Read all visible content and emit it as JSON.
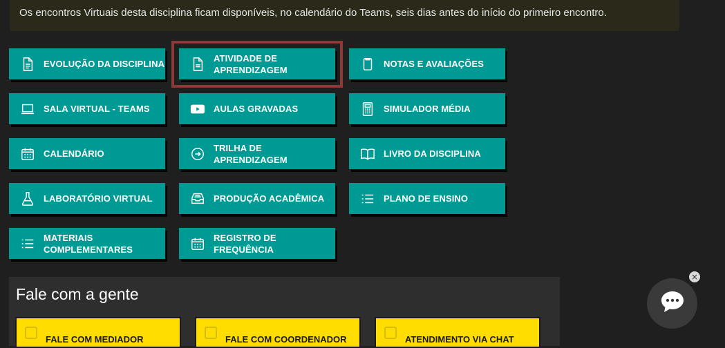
{
  "notice": {
    "text": "Os encontros Virtuais desta disciplina ficam disponíveis, no calendário do Teams, seis dias antes do início do primeiro encontro."
  },
  "menu": {
    "evolucao": "EVOLUÇÃO DA DISCIPLINA",
    "atividade_l1": "ATIVIDADE DE",
    "atividade_l2": "APRENDIZAGEM",
    "notas": "NOTAS E AVALIAÇÕES",
    "sala": "SALA VIRTUAL - TEAMS",
    "aulas": "AULAS GRAVADAS",
    "simulador": "SIMULADOR MÉDIA",
    "calendario": "CALENDÁRIO",
    "trilha_l1": "TRILHA DE",
    "trilha_l2": "APRENDIZAGEM",
    "livro": "LIVRO DA DISCIPLINA",
    "laboratorio": "LABORATÓRIO VIRTUAL",
    "producao": "PRODUÇÃO ACADÊMICA",
    "plano": "PLANO DE ENSINO",
    "materiais_l1": "MATERIAIS",
    "materiais_l2": "COMPLEMENTARES",
    "registro": "REGISTRO DE FREQUÊNCIA"
  },
  "contact": {
    "title": "Fale com a gente",
    "mediador": "FALE COM MEDIADOR",
    "coordenador": "FALE COM COORDENADOR",
    "chat": "ATENDIMENTO VIA CHAT"
  },
  "chat_widget": {
    "close_symbol": "×"
  },
  "colors": {
    "teal": "#009a95",
    "yellow": "#ffdd00",
    "highlight": "#8a3b36"
  }
}
